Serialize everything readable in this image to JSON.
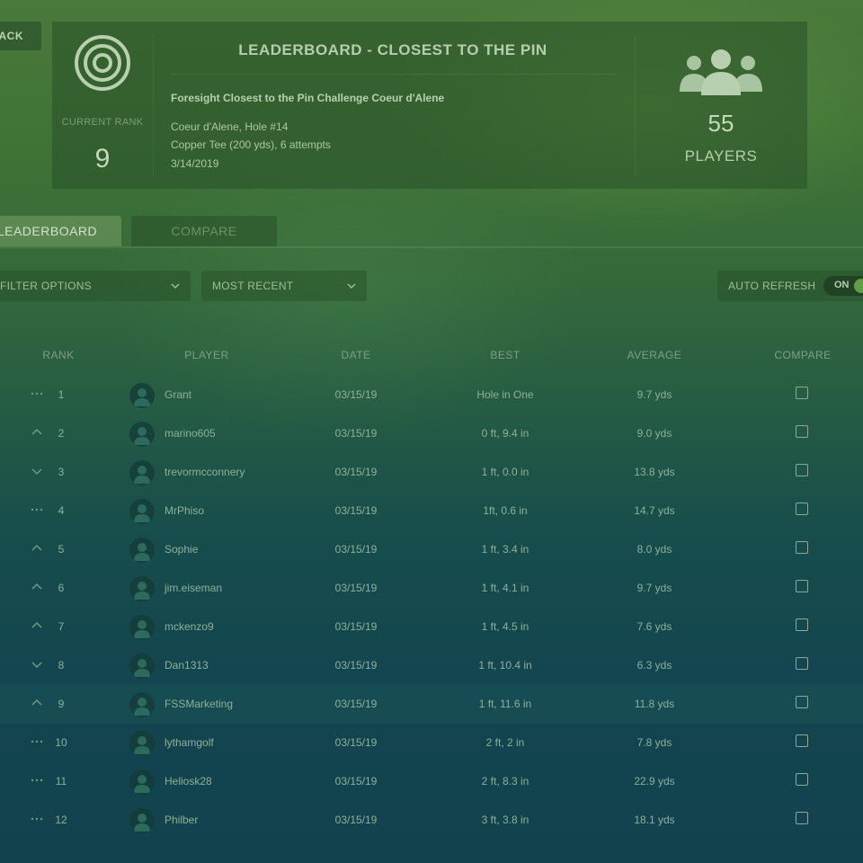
{
  "back_label": "BACK",
  "header": {
    "title": "LEADERBOARD - CLOSEST TO THE PIN",
    "current_rank_label": "CURRENT RANK",
    "current_rank": "9",
    "event_name": "Foresight Closest to the Pin Challenge Coeur d'Alene",
    "course": "Coeur d'Alene, Hole #14",
    "tee": "Copper Tee (200 yds), 6 attempts",
    "date": "3/14/2019",
    "players_count": "55",
    "players_label": "PLAYERS"
  },
  "tabs": [
    {
      "label": "LEADERBOARD",
      "active": true
    },
    {
      "label": "COMPARE",
      "active": false
    }
  ],
  "filters": {
    "filter_options": "FILTER OPTIONS",
    "sort": "MOST RECENT",
    "auto_refresh_label": "AUTO REFRESH",
    "auto_refresh_state": "ON"
  },
  "table": {
    "columns": [
      "RANK",
      "PLAYER",
      "DATE",
      "BEST",
      "AVERAGE",
      "COMPARE"
    ],
    "rows": [
      {
        "trend": "same",
        "rank": "1",
        "player": "Grant",
        "date": "03/15/19",
        "best": "Hole in One",
        "average": "9.7 yds"
      },
      {
        "trend": "up",
        "rank": "2",
        "player": "marino605",
        "date": "03/15/19",
        "best": "0 ft, 9.4 in",
        "average": "9.0 yds"
      },
      {
        "trend": "down",
        "rank": "3",
        "player": "trevormcconnery",
        "date": "03/15/19",
        "best": "1 ft, 0.0 in",
        "average": "13.8 yds"
      },
      {
        "trend": "same",
        "rank": "4",
        "player": "MrPhiso",
        "date": "03/15/19",
        "best": "1ft, 0.6 in",
        "average": "14.7 yds"
      },
      {
        "trend": "up",
        "rank": "5",
        "player": "Sophie",
        "date": "03/15/19",
        "best": "1 ft, 3.4 in",
        "average": "8.0 yds"
      },
      {
        "trend": "up",
        "rank": "6",
        "player": "jim.eiseman",
        "date": "03/15/19",
        "best": "1 ft, 4.1 in",
        "average": "9.7 yds"
      },
      {
        "trend": "up",
        "rank": "7",
        "player": "mckenzo9",
        "date": "03/15/19",
        "best": "1 ft, 4.5 in",
        "average": "7.6 yds"
      },
      {
        "trend": "down",
        "rank": "8",
        "player": "Dan1313",
        "date": "03/15/19",
        "best": "1 ft, 10.4 in",
        "average": "6.3 yds"
      },
      {
        "trend": "up",
        "rank": "9",
        "player": "FSSMarketing",
        "date": "03/15/19",
        "best": "1 ft, 11.6 in",
        "average": "11.8 yds",
        "highlight": true
      },
      {
        "trend": "same",
        "rank": "10",
        "player": "lythamgolf",
        "date": "03/15/19",
        "best": "2 ft, 2 in",
        "average": "7.8 yds"
      },
      {
        "trend": "same",
        "rank": "11",
        "player": "Heliosk28",
        "date": "03/15/19",
        "best": "2 ft, 8.3 in",
        "average": "22.9 yds"
      },
      {
        "trend": "same",
        "rank": "12",
        "player": "Philber",
        "date": "03/15/19",
        "best": "3 ft, 3.8 in",
        "average": "18.1 yds"
      }
    ]
  },
  "colors": {
    "accent_green": "#5fa045",
    "highlight_row": "#1e5a5a"
  }
}
